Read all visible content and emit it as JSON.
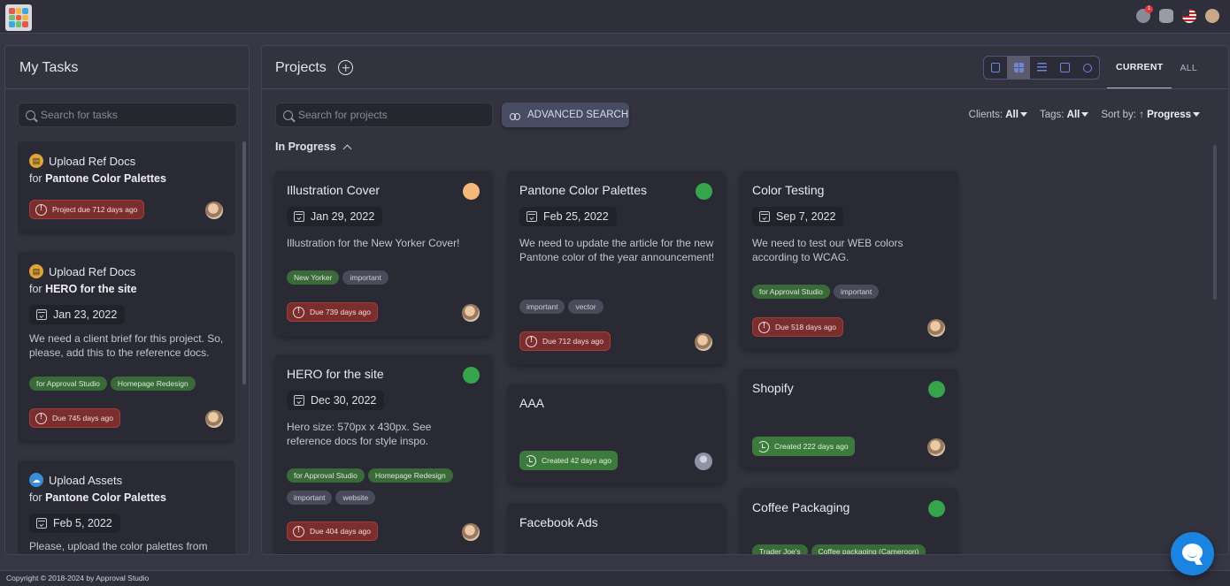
{
  "app": {
    "logo_colors": [
      "#e25b4b",
      "#f4b740",
      "#3fa8d8",
      "#6cc070",
      "#e25b4b",
      "#f4b740",
      "#3fa8d8",
      "#6cc070",
      "#e25b4b"
    ],
    "notifications_count": "1"
  },
  "my_tasks": {
    "title": "My Tasks",
    "search_placeholder": "Search for tasks",
    "cards": [
      {
        "type_icon": "document-icon",
        "type_color": "#e0a436",
        "name": "Upload Ref Docs",
        "for_prefix": "for ",
        "project": "Pantone Color Palettes",
        "due_label": "Project due 712 days ago"
      },
      {
        "type_icon": "document-icon",
        "type_color": "#e0a436",
        "name": "Upload Ref Docs",
        "for_prefix": "for ",
        "project": "HERO for the site",
        "date": "Jan 23, 2022",
        "description": "We need a client brief for this project. So, please, add this to the reference docs.",
        "tags": [
          "for Approval Studio",
          "Homepage Redesign"
        ],
        "due_label": "Due 745 days ago"
      },
      {
        "type_icon": "upload-cloud-icon",
        "type_color": "#3b8ed6",
        "name": "Upload Assets",
        "for_prefix": "for ",
        "project": "Pantone Color Palettes",
        "date": "Feb 5, 2022",
        "description": "Please, upload the color palettes from"
      }
    ]
  },
  "projects": {
    "title": "Projects",
    "search_placeholder": "Search for projects",
    "advanced_search_label": "ADVANCED SEARCH",
    "scope_tabs": [
      "CURRENT",
      "ALL"
    ],
    "filters": {
      "clients_label": "Clients:",
      "clients_value": "All",
      "tags_label": "Tags:",
      "tags_value": "All",
      "sort_label": "Sort by:",
      "sort_arrow": "↑",
      "sort_value": "Progress"
    },
    "group_label": "In Progress",
    "cards": [
      {
        "title": "Illustration Cover",
        "status": "orange",
        "date": "Jan 29, 2022",
        "description": "Illustration for the New Yorker Cover!",
        "tags": [
          "New Yorker",
          "important"
        ],
        "due_label": "Due 739 days ago"
      },
      {
        "title": "HERO for the site",
        "status": "green",
        "date": "Dec 30, 2022",
        "description": "Hero size: 570px x 430px. See reference docs for style inspo.",
        "tags": [
          "for Approval Studio",
          "Homepage Redesign",
          "important",
          "website"
        ],
        "due_label": "Due 404 days ago"
      },
      {
        "title": "Pantone Color Palettes",
        "status": "green",
        "date": "Feb 25, 2022",
        "description": "We need to update the article for the new Pantone color of the year announcement!",
        "tags": [
          "important",
          "vector"
        ],
        "due_label": "Due 712 days ago"
      },
      {
        "title": "AAA",
        "created_label": "Created 42 days ago"
      },
      {
        "title": "Facebook Ads"
      },
      {
        "title": "Color Testing",
        "date": "Sep 7, 2022",
        "description": "We need to test our WEB colors according to WCAG.",
        "tags": [
          "for Approval Studio",
          "important"
        ],
        "due_label": "Due 518 days ago"
      },
      {
        "title": "Shopify",
        "status": "green",
        "created_label": "Created 222 days ago"
      },
      {
        "title": "Coffee Packaging",
        "status": "green",
        "tags": [
          "Trader Joe's",
          "Coffee packaging (Cameroon)"
        ]
      }
    ]
  },
  "footer": {
    "copyright": "Copyright © 2018-2024 by Approval Studio"
  }
}
